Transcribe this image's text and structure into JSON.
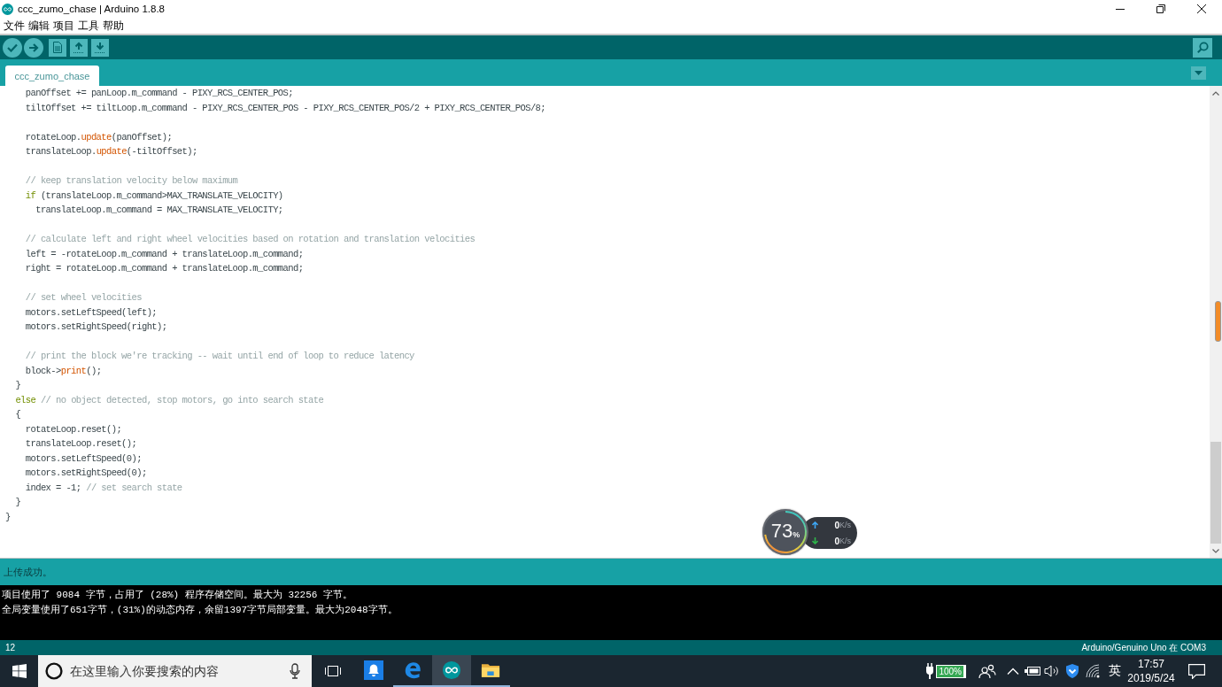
{
  "window": {
    "title": "ccc_zumo_chase | Arduino 1.8.8"
  },
  "menu": [
    "文件",
    "编辑",
    "项目",
    "工具",
    "帮助"
  ],
  "tabs": [
    {
      "label": "ccc_zumo_chase",
      "selected": true
    }
  ],
  "code_blocks": [
    {
      "lines": [
        [
          {
            "kind": "plain",
            "text": "    panOffset += panLoop.m_command - PIXY_RCS_CENTER_POS;"
          }
        ],
        [
          {
            "kind": "plain",
            "text": "    tiltOffset += tiltLoop.m_command - PIXY_RCS_CENTER_POS - PIXY_RCS_CENTER_POS/2 + PIXY_RCS_CENTER_POS/8;"
          }
        ]
      ]
    },
    {
      "lines": [
        [
          {
            "kind": "plain",
            "text": "    rotateLoop."
          },
          {
            "kind": "function",
            "text": "update"
          },
          {
            "kind": "plain",
            "text": "(panOffset);"
          }
        ],
        [
          {
            "kind": "plain",
            "text": "    translateLoop."
          },
          {
            "kind": "function",
            "text": "update"
          },
          {
            "kind": "plain",
            "text": "(-tiltOffset);"
          }
        ]
      ]
    },
    {
      "lines": [
        [
          {
            "kind": "comment",
            "text": "    // keep translation velocity below maximum"
          }
        ],
        [
          {
            "kind": "keyword",
            "text": "    if"
          },
          {
            "kind": "plain",
            "text": " (translateLoop.m_command>MAX_TRANSLATE_VELOCITY)"
          }
        ],
        [
          {
            "kind": "plain",
            "text": "      translateLoop.m_command = MAX_TRANSLATE_VELOCITY;"
          }
        ]
      ]
    },
    {
      "lines": [
        [
          {
            "kind": "comment",
            "text": "    // calculate left and right wheel velocities based on rotation and translation velocities"
          }
        ],
        [
          {
            "kind": "plain",
            "text": "    left = -rotateLoop.m_command + translateLoop.m_command;"
          }
        ],
        [
          {
            "kind": "plain",
            "text": "    right = rotateLoop.m_command + translateLoop.m_command;"
          }
        ]
      ]
    },
    {
      "lines": [
        [
          {
            "kind": "comment",
            "text": "    // set wheel velocities"
          }
        ],
        [
          {
            "kind": "plain",
            "text": "    motors.setLeftSpeed(left);"
          }
        ],
        [
          {
            "kind": "plain",
            "text": "    motors.setRightSpeed(right);"
          }
        ]
      ]
    },
    {
      "lines": [
        [
          {
            "kind": "comment",
            "text": "    // print the block we're tracking -- wait until end of loop to reduce latency"
          }
        ],
        [
          {
            "kind": "plain",
            "text": "    block->"
          },
          {
            "kind": "function",
            "text": "print"
          },
          {
            "kind": "plain",
            "text": "();"
          }
        ],
        [
          {
            "kind": "plain",
            "text": "  }"
          }
        ],
        [
          {
            "kind": "keyword",
            "text": "  else"
          },
          {
            "kind": "comment",
            "text": " // no object detected, stop motors, go into search state"
          }
        ],
        [
          {
            "kind": "plain",
            "text": "  {"
          }
        ],
        [
          {
            "kind": "plain",
            "text": "    rotateLoop.reset();"
          }
        ],
        [
          {
            "kind": "plain",
            "text": "    translateLoop.reset();"
          }
        ],
        [
          {
            "kind": "plain",
            "text": "    motors.setLeftSpeed(0);"
          }
        ],
        [
          {
            "kind": "plain",
            "text": "    motors.setRightSpeed(0);"
          }
        ],
        [
          {
            "kind": "plain",
            "text": "    index = -1; "
          },
          {
            "kind": "comment",
            "text": "// set search state"
          }
        ],
        [
          {
            "kind": "plain",
            "text": "  }"
          }
        ],
        [
          {
            "kind": "plain",
            "text": "}"
          }
        ]
      ]
    }
  ],
  "memory_widget": {
    "percent": "73",
    "unit": "%",
    "upload": {
      "value": "0",
      "unit": "K/s"
    },
    "download": {
      "value": "0",
      "unit": "K/s"
    }
  },
  "status": {
    "message": "上传成功。"
  },
  "console": {
    "lines": [
      "项目使用了 9084 字节，占用了 (28%) 程序存储空间。最大为 32256 字节。",
      "全局变量使用了651字节，(31%)的动态内存，余留1397字节局部变量。最大为2048字节。"
    ]
  },
  "footer": {
    "line": "12",
    "board": "Arduino/Genuino Uno 在 COM3"
  },
  "taskbar": {
    "search": {
      "placeholder": "在这里输入你要搜索的内容"
    },
    "apps": [
      {
        "kind": "bell",
        "running": false,
        "selected": false
      },
      {
        "kind": "browser",
        "running": true,
        "selected": false
      },
      {
        "kind": "arduino",
        "running": true,
        "selected": true
      },
      {
        "kind": "folder",
        "running": true,
        "selected": false
      }
    ],
    "tray": {
      "battery": "100%",
      "language": "英",
      "time": "17:57",
      "date": "2019/5/24"
    }
  }
}
